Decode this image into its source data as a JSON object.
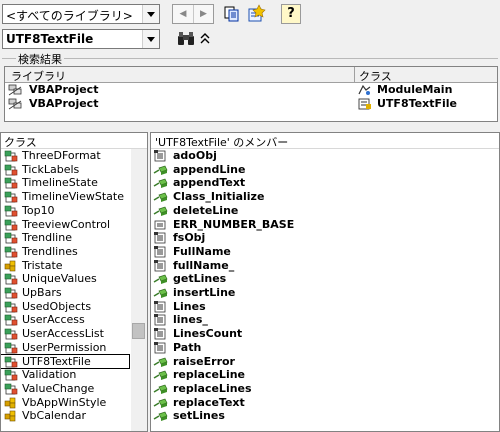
{
  "toolbar": {
    "library_value": "<すべてのライブラリ>",
    "search_value": "UTF8TextFile",
    "back_label": "◀",
    "forward_label": "▶",
    "help_label": "?"
  },
  "search_results": {
    "title": "検索結果",
    "col_library": "ライブラリ",
    "col_class": "クラス",
    "rows": [
      {
        "library": "VBAProject",
        "class": "ModuleMain"
      },
      {
        "library": "VBAProject",
        "class": "UTF8TextFile"
      }
    ]
  },
  "classes": {
    "header": "クラス",
    "items": [
      "ThreeDFormat",
      "TickLabels",
      "TimelineState",
      "TimelineViewState",
      "Top10",
      "TreeviewControl",
      "Trendline",
      "Trendlines",
      "Tristate",
      "UniqueValues",
      "UpBars",
      "UsedObjects",
      "UserAccess",
      "UserAccessList",
      "UserPermission",
      "UTF8TextFile",
      "Validation",
      "ValueChange",
      "VbAppWinStyle",
      "VbCalendar"
    ],
    "selected": "UTF8TextFile"
  },
  "members": {
    "header": "'UTF8TextFile' のメンバー",
    "items": [
      {
        "name": "adoObj",
        "icon": "property-icon"
      },
      {
        "name": "appendLine",
        "icon": "method-icon"
      },
      {
        "name": "appendText",
        "icon": "method-icon"
      },
      {
        "name": "Class_Initialize",
        "icon": "method-icon"
      },
      {
        "name": "deleteLine",
        "icon": "method-icon"
      },
      {
        "name": "ERR_NUMBER_BASE",
        "icon": "constant-icon"
      },
      {
        "name": "fsObj",
        "icon": "property-icon"
      },
      {
        "name": "FullName",
        "icon": "property-icon"
      },
      {
        "name": "fullName_",
        "icon": "property-icon"
      },
      {
        "name": "getLines",
        "icon": "method-icon"
      },
      {
        "name": "insertLine",
        "icon": "method-icon"
      },
      {
        "name": "Lines",
        "icon": "property-icon"
      },
      {
        "name": "lines_",
        "icon": "property-icon"
      },
      {
        "name": "LinesCount",
        "icon": "property-icon"
      },
      {
        "name": "Path",
        "icon": "property-icon"
      },
      {
        "name": "raiseError",
        "icon": "method-icon"
      },
      {
        "name": "replaceLine",
        "icon": "method-icon"
      },
      {
        "name": "replaceLines",
        "icon": "method-icon"
      },
      {
        "name": "replaceText",
        "icon": "method-icon"
      },
      {
        "name": "setLines",
        "icon": "method-icon"
      }
    ]
  }
}
